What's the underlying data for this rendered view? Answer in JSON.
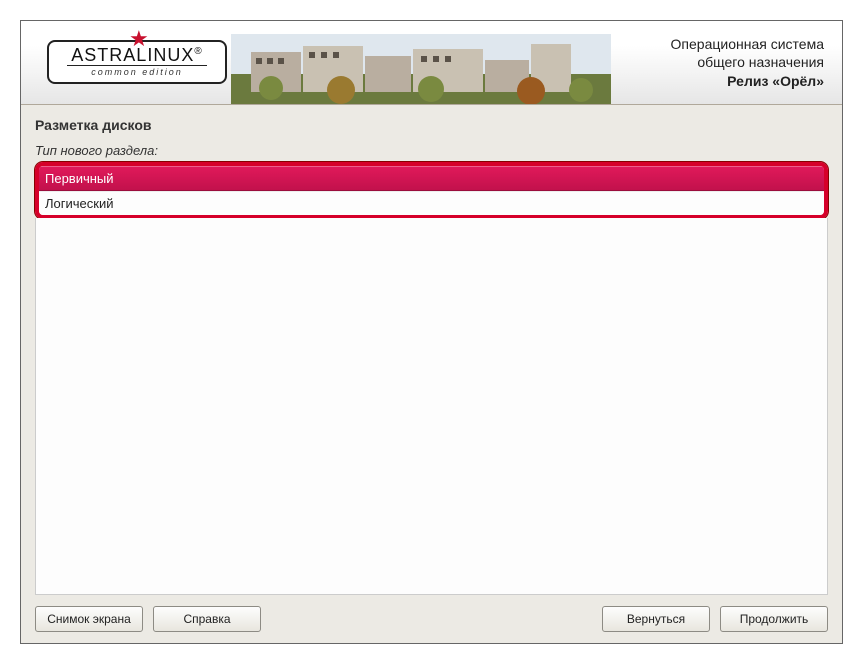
{
  "logo": {
    "brand": "Astralinux",
    "reg": "®",
    "edition": "common edition"
  },
  "banner": {
    "line1": "Операционная система",
    "line2": "общего назначения",
    "line3": "Релиз «Орёл»"
  },
  "page_title": "Разметка дисков",
  "prompt": "Тип нового раздела:",
  "options": [
    {
      "label": "Первичный",
      "selected": true
    },
    {
      "label": "Логический",
      "selected": false
    }
  ],
  "buttons": {
    "screenshot": "Снимок экрана",
    "help": "Справка",
    "back": "Вернуться",
    "continue": "Продолжить"
  }
}
